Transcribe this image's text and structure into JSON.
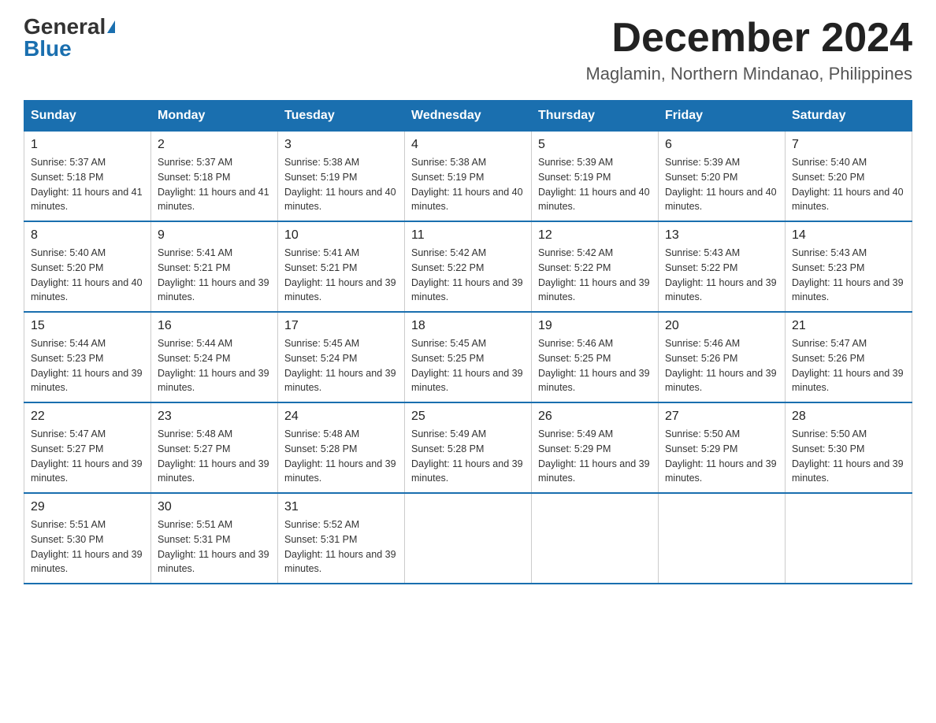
{
  "logo": {
    "general": "General",
    "blue": "Blue"
  },
  "title": {
    "month": "December 2024",
    "location": "Maglamin, Northern Mindanao, Philippines"
  },
  "headers": [
    "Sunday",
    "Monday",
    "Tuesday",
    "Wednesday",
    "Thursday",
    "Friday",
    "Saturday"
  ],
  "weeks": [
    [
      {
        "day": "1",
        "sunrise": "Sunrise: 5:37 AM",
        "sunset": "Sunset: 5:18 PM",
        "daylight": "Daylight: 11 hours and 41 minutes."
      },
      {
        "day": "2",
        "sunrise": "Sunrise: 5:37 AM",
        "sunset": "Sunset: 5:18 PM",
        "daylight": "Daylight: 11 hours and 41 minutes."
      },
      {
        "day": "3",
        "sunrise": "Sunrise: 5:38 AM",
        "sunset": "Sunset: 5:19 PM",
        "daylight": "Daylight: 11 hours and 40 minutes."
      },
      {
        "day": "4",
        "sunrise": "Sunrise: 5:38 AM",
        "sunset": "Sunset: 5:19 PM",
        "daylight": "Daylight: 11 hours and 40 minutes."
      },
      {
        "day": "5",
        "sunrise": "Sunrise: 5:39 AM",
        "sunset": "Sunset: 5:19 PM",
        "daylight": "Daylight: 11 hours and 40 minutes."
      },
      {
        "day": "6",
        "sunrise": "Sunrise: 5:39 AM",
        "sunset": "Sunset: 5:20 PM",
        "daylight": "Daylight: 11 hours and 40 minutes."
      },
      {
        "day": "7",
        "sunrise": "Sunrise: 5:40 AM",
        "sunset": "Sunset: 5:20 PM",
        "daylight": "Daylight: 11 hours and 40 minutes."
      }
    ],
    [
      {
        "day": "8",
        "sunrise": "Sunrise: 5:40 AM",
        "sunset": "Sunset: 5:20 PM",
        "daylight": "Daylight: 11 hours and 40 minutes."
      },
      {
        "day": "9",
        "sunrise": "Sunrise: 5:41 AM",
        "sunset": "Sunset: 5:21 PM",
        "daylight": "Daylight: 11 hours and 39 minutes."
      },
      {
        "day": "10",
        "sunrise": "Sunrise: 5:41 AM",
        "sunset": "Sunset: 5:21 PM",
        "daylight": "Daylight: 11 hours and 39 minutes."
      },
      {
        "day": "11",
        "sunrise": "Sunrise: 5:42 AM",
        "sunset": "Sunset: 5:22 PM",
        "daylight": "Daylight: 11 hours and 39 minutes."
      },
      {
        "day": "12",
        "sunrise": "Sunrise: 5:42 AM",
        "sunset": "Sunset: 5:22 PM",
        "daylight": "Daylight: 11 hours and 39 minutes."
      },
      {
        "day": "13",
        "sunrise": "Sunrise: 5:43 AM",
        "sunset": "Sunset: 5:22 PM",
        "daylight": "Daylight: 11 hours and 39 minutes."
      },
      {
        "day": "14",
        "sunrise": "Sunrise: 5:43 AM",
        "sunset": "Sunset: 5:23 PM",
        "daylight": "Daylight: 11 hours and 39 minutes."
      }
    ],
    [
      {
        "day": "15",
        "sunrise": "Sunrise: 5:44 AM",
        "sunset": "Sunset: 5:23 PM",
        "daylight": "Daylight: 11 hours and 39 minutes."
      },
      {
        "day": "16",
        "sunrise": "Sunrise: 5:44 AM",
        "sunset": "Sunset: 5:24 PM",
        "daylight": "Daylight: 11 hours and 39 minutes."
      },
      {
        "day": "17",
        "sunrise": "Sunrise: 5:45 AM",
        "sunset": "Sunset: 5:24 PM",
        "daylight": "Daylight: 11 hours and 39 minutes."
      },
      {
        "day": "18",
        "sunrise": "Sunrise: 5:45 AM",
        "sunset": "Sunset: 5:25 PM",
        "daylight": "Daylight: 11 hours and 39 minutes."
      },
      {
        "day": "19",
        "sunrise": "Sunrise: 5:46 AM",
        "sunset": "Sunset: 5:25 PM",
        "daylight": "Daylight: 11 hours and 39 minutes."
      },
      {
        "day": "20",
        "sunrise": "Sunrise: 5:46 AM",
        "sunset": "Sunset: 5:26 PM",
        "daylight": "Daylight: 11 hours and 39 minutes."
      },
      {
        "day": "21",
        "sunrise": "Sunrise: 5:47 AM",
        "sunset": "Sunset: 5:26 PM",
        "daylight": "Daylight: 11 hours and 39 minutes."
      }
    ],
    [
      {
        "day": "22",
        "sunrise": "Sunrise: 5:47 AM",
        "sunset": "Sunset: 5:27 PM",
        "daylight": "Daylight: 11 hours and 39 minutes."
      },
      {
        "day": "23",
        "sunrise": "Sunrise: 5:48 AM",
        "sunset": "Sunset: 5:27 PM",
        "daylight": "Daylight: 11 hours and 39 minutes."
      },
      {
        "day": "24",
        "sunrise": "Sunrise: 5:48 AM",
        "sunset": "Sunset: 5:28 PM",
        "daylight": "Daylight: 11 hours and 39 minutes."
      },
      {
        "day": "25",
        "sunrise": "Sunrise: 5:49 AM",
        "sunset": "Sunset: 5:28 PM",
        "daylight": "Daylight: 11 hours and 39 minutes."
      },
      {
        "day": "26",
        "sunrise": "Sunrise: 5:49 AM",
        "sunset": "Sunset: 5:29 PM",
        "daylight": "Daylight: 11 hours and 39 minutes."
      },
      {
        "day": "27",
        "sunrise": "Sunrise: 5:50 AM",
        "sunset": "Sunset: 5:29 PM",
        "daylight": "Daylight: 11 hours and 39 minutes."
      },
      {
        "day": "28",
        "sunrise": "Sunrise: 5:50 AM",
        "sunset": "Sunset: 5:30 PM",
        "daylight": "Daylight: 11 hours and 39 minutes."
      }
    ],
    [
      {
        "day": "29",
        "sunrise": "Sunrise: 5:51 AM",
        "sunset": "Sunset: 5:30 PM",
        "daylight": "Daylight: 11 hours and 39 minutes."
      },
      {
        "day": "30",
        "sunrise": "Sunrise: 5:51 AM",
        "sunset": "Sunset: 5:31 PM",
        "daylight": "Daylight: 11 hours and 39 minutes."
      },
      {
        "day": "31",
        "sunrise": "Sunrise: 5:52 AM",
        "sunset": "Sunset: 5:31 PM",
        "daylight": "Daylight: 11 hours and 39 minutes."
      },
      null,
      null,
      null,
      null
    ]
  ]
}
